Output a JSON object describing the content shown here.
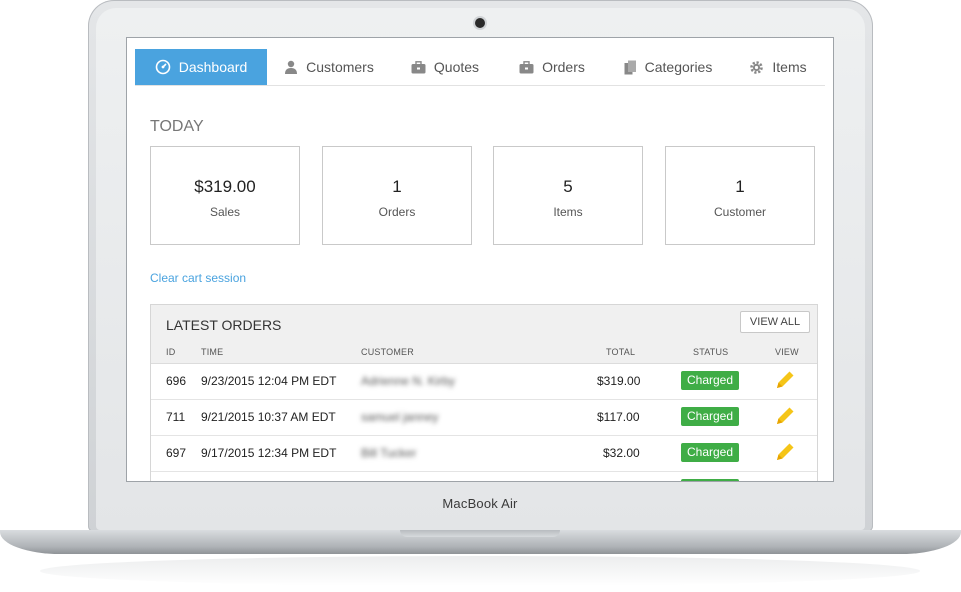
{
  "device": {
    "brand": "MacBook Air"
  },
  "nav": [
    {
      "label": "Dashboard",
      "icon": "dashboard-icon",
      "active": true
    },
    {
      "label": "Customers",
      "icon": "user-icon",
      "active": false
    },
    {
      "label": "Quotes",
      "icon": "briefcase-icon",
      "active": false
    },
    {
      "label": "Orders",
      "icon": "briefcase-icon",
      "active": false
    },
    {
      "label": "Categories",
      "icon": "files-icon",
      "active": false
    },
    {
      "label": "Items",
      "icon": "gear-icon",
      "active": false
    }
  ],
  "today": {
    "heading": "TODAY",
    "stats": [
      {
        "value": "$319.00",
        "label": "Sales"
      },
      {
        "value": "1",
        "label": "Orders"
      },
      {
        "value": "5",
        "label": "Items"
      },
      {
        "value": "1",
        "label": "Customer"
      }
    ]
  },
  "clear_link": "Clear cart session",
  "orders": {
    "title": "LATEST ORDERS",
    "view_all": "VIEW ALL",
    "columns": {
      "id": "ID",
      "time": "TIME",
      "customer": "CUSTOMER",
      "total": "TOTAL",
      "status": "STATUS",
      "view": "VIEW"
    },
    "rows": [
      {
        "id": "696",
        "time": "9/23/2015 12:04 PM EDT",
        "customer": "Adrienne N. Kirby",
        "total": "$319.00",
        "status": "Charged"
      },
      {
        "id": "711",
        "time": "9/21/2015 10:37 AM EDT",
        "customer": "samuel janney",
        "total": "$117.00",
        "status": "Charged"
      },
      {
        "id": "697",
        "time": "9/17/2015 12:34 PM EDT",
        "customer": "Bill Tucker",
        "total": "$32.00",
        "status": "Charged"
      }
    ]
  },
  "colors": {
    "accent": "#4aa3df",
    "charged": "#3fad46",
    "pencil": "#f5c518"
  }
}
